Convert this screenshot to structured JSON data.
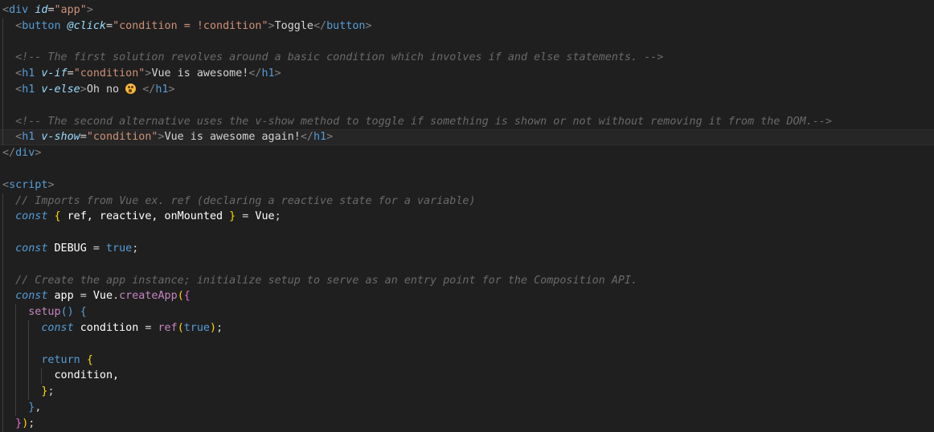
{
  "code": {
    "l1": {
      "a": "<",
      "b": "div",
      "c": " ",
      "d": "id",
      "e": "=",
      "f": "\"app\"",
      "g": ">"
    },
    "l2": {
      "a": "<",
      "b": "button",
      "c": " ",
      "d": "@click",
      "e": "=",
      "f": "\"condition = !condition\"",
      "g": ">",
      "h": "Toggle",
      "i": "</",
      "j": "button",
      "k": ">"
    },
    "l4": {
      "a": "<!-- The first solution revolves around a basic condition which involves if and else statements. -->"
    },
    "l5": {
      "a": "<",
      "b": "h1",
      "c": " ",
      "d": "v-if",
      "e": "=",
      "f": "\"condition\"",
      "g": ">",
      "h": "Vue is awesome!",
      "i": "</",
      "j": "h1",
      "k": ">"
    },
    "l6": {
      "a": "<",
      "b": "h1",
      "c": " ",
      "d": "v-else",
      "g": ">",
      "h": "Oh no ",
      "emoji": "flushed-face-emoji",
      "h2": " ",
      "i": "</",
      "j": "h1",
      "k": ">"
    },
    "l8": {
      "a": "<!-- The second alternative uses the v-show method to toggle if something is shown or not without removing it from the DOM.-->"
    },
    "l9": {
      "a": "<",
      "b": "h1",
      "c": " ",
      "d": "v-show",
      "e": "=",
      "f": "\"condition\"",
      "g": ">",
      "h": "Vue is awesome again!",
      "i": "</",
      "j": "h1",
      "k": ">"
    },
    "l10": {
      "a": "</",
      "b": "div",
      "c": ">"
    },
    "l12": {
      "a": "<",
      "b": "script",
      "c": ">"
    },
    "l13": {
      "a": "// Imports from Vue ex. ref (declaring a reactive state for a variable)"
    },
    "l14": {
      "a": "const",
      "b": " ",
      "c": "{",
      "d": " ref, reactive, onMounted ",
      "e": "}",
      "f": " = ",
      "g": "Vue",
      "h": ";"
    },
    "l16": {
      "a": "const",
      "b": " DEBUG ",
      "c": "=",
      "d": " ",
      "e": "true",
      "f": ";"
    },
    "l18": {
      "a": "// Create the app instance; initialize setup to serve as an entry point for the Composition API."
    },
    "l19": {
      "a": "const",
      "b": " app ",
      "c": "=",
      "d": " Vue",
      "e": ".",
      "f": "createApp",
      "g": "(",
      "h": "{"
    },
    "l20": {
      "a": "setup",
      "b": "()",
      "c": " ",
      "d": "{"
    },
    "l21": {
      "a": "const",
      "b": " condition ",
      "c": "=",
      "d": " ",
      "e": "ref",
      "f": "(",
      "g": "true",
      "h": ")",
      "i": ";"
    },
    "l23": {
      "a": "return",
      "b": " ",
      "c": "{"
    },
    "l24": {
      "a": "condition,"
    },
    "l25": {
      "a": "}",
      "b": ";"
    },
    "l26": {
      "a": "}",
      "b": ","
    },
    "l27": {
      "a": "}",
      "b": ")",
      "c": ";"
    }
  },
  "colors": {
    "background": "#1f1f1f",
    "tag": "#569cd6",
    "attribute": "#9cdcfe",
    "string": "#ce9178",
    "comment": "#6a6a6a",
    "bracket_level1": "#ffd700",
    "bracket_level2": "#da70d6",
    "bracket_level3": "#179fff",
    "function": "#dcdcaa"
  }
}
